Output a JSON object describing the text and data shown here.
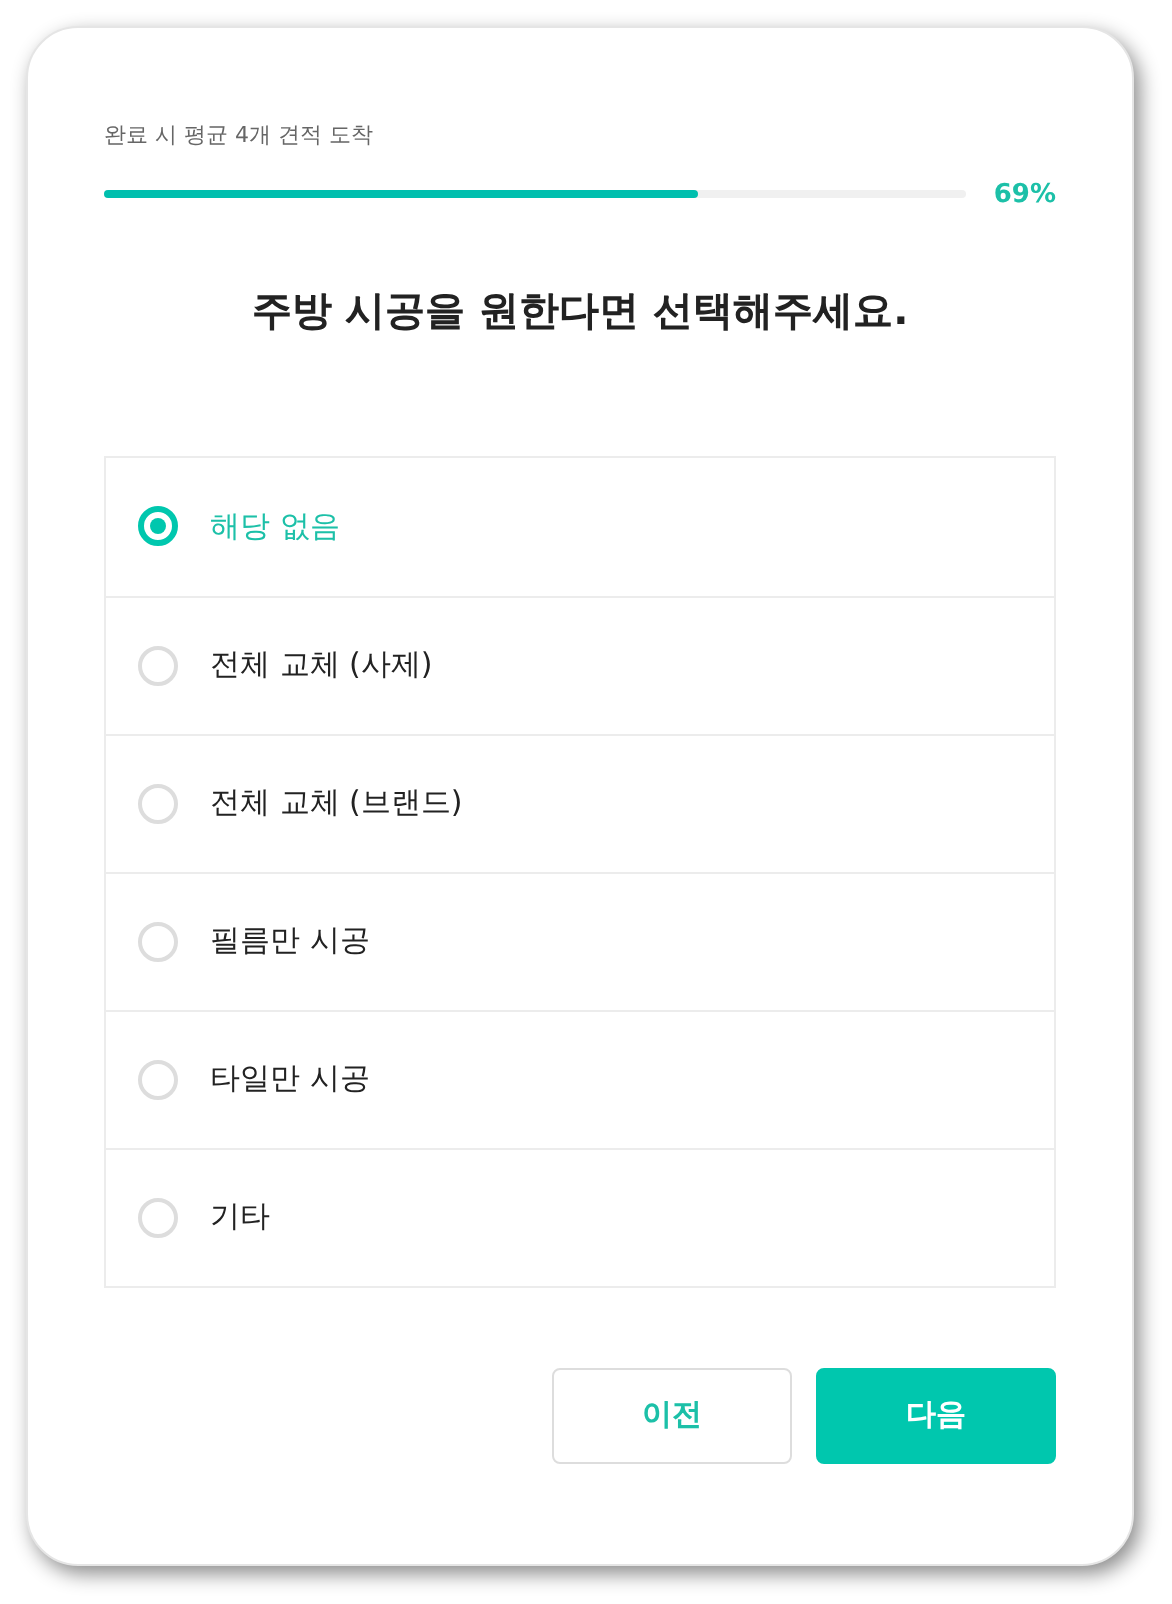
{
  "progress": {
    "label": "완료 시 평균 4개 견적 도착",
    "level": 0.69,
    "reading": "69%"
  },
  "question": "주방 시공을 원한다면 선택해주세요.",
  "options": [
    {
      "label": "해당 없음",
      "selected": true
    },
    {
      "label": "전체 교체 (사제)",
      "selected": false
    },
    {
      "label": "전체 교체 (브랜드)",
      "selected": false
    },
    {
      "label": "필름만 시공",
      "selected": false
    },
    {
      "label": "타일만 시공",
      "selected": false
    },
    {
      "label": "기타",
      "selected": false
    }
  ],
  "buttons": [
    {
      "label": "이전",
      "kind": "secondary"
    },
    {
      "label": "다음",
      "kind": "primary"
    }
  ]
}
